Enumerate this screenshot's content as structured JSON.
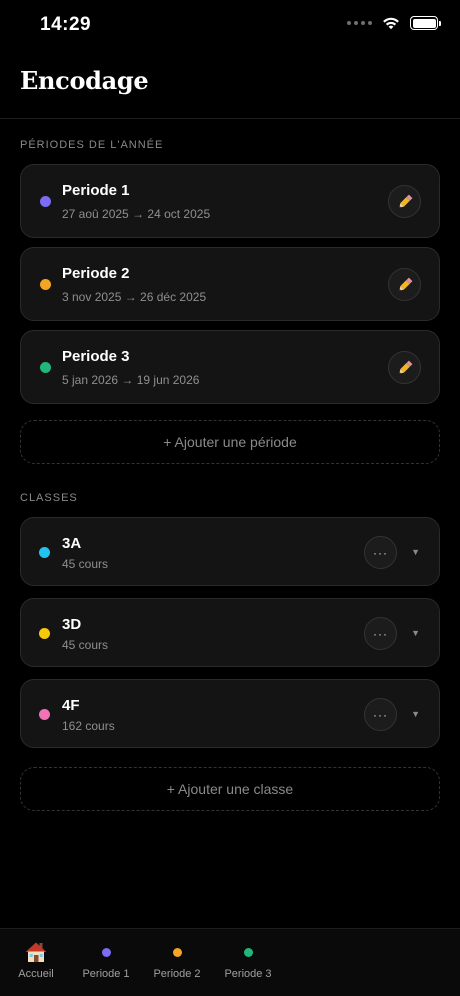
{
  "status_bar": {
    "time": "14:29"
  },
  "header": {
    "title": "Encodage"
  },
  "periods_section": {
    "label": "PÉRIODES DE L'ANNÉE",
    "items": [
      {
        "title": "Periode 1",
        "range": "27 aoû 2025 → 24 oct 2025",
        "color": "#7b6cf6"
      },
      {
        "title": "Periode 2",
        "range": "3 nov 2025 → 26 déc 2025",
        "color": "#f5a524"
      },
      {
        "title": "Periode 3",
        "range": "5 jan 2026 → 19 jun 2026",
        "color": "#1fb87a"
      }
    ],
    "add_label": "+ Ajouter une période"
  },
  "classes_section": {
    "label": "CLASSES",
    "items": [
      {
        "name": "3A",
        "count": "45 cours",
        "color": "#22c3ee"
      },
      {
        "name": "3D",
        "count": "45 cours",
        "color": "#f7c90c"
      },
      {
        "name": "4F",
        "count": "162 cours",
        "color": "#f472b6"
      }
    ],
    "more_glyph": "···",
    "chevron_glyph": "▼",
    "add_label": "+ Ajouter une classe"
  },
  "tab_bar": {
    "tabs": [
      {
        "label": "Accueil",
        "icon": "house-icon"
      },
      {
        "label": "Periode 1",
        "color": "#7b6cf6"
      },
      {
        "label": "Periode 2",
        "color": "#f5a524"
      },
      {
        "label": "Periode 3",
        "color": "#1fb87a"
      }
    ]
  }
}
